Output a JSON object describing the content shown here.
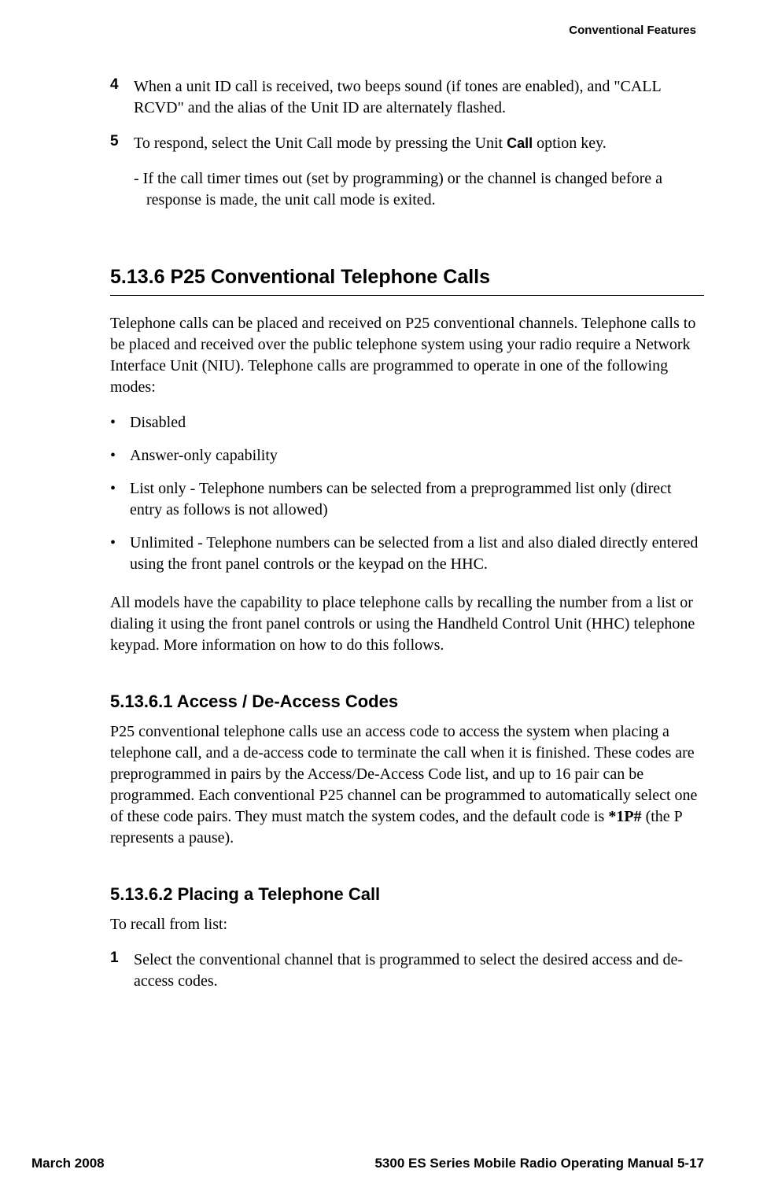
{
  "header": {
    "section_title": "Conventional Features"
  },
  "steps": {
    "step4_num": "4",
    "step4_text": "When a unit ID call is received, two beeps sound (if tones are enabled), and \"CALL RCVD\" and the alias of the Unit ID are alternately flashed.",
    "step5_num": "5",
    "step5_text_a": "To respond, select the Unit Call mode by pressing the Unit ",
    "step5_bold": "Call",
    "step5_text_b": " option key.",
    "step5_sub": "-  If the call timer times out (set by programming) or the channel is changed before a response is made, the unit call mode is exited."
  },
  "section_5_13_6": {
    "heading": "5.13.6   P25 Conventional Telephone Calls",
    "para_intro": "Telephone calls can be placed and received on P25 conventional channels. Telephone calls to be placed and received over the public telephone system using your radio require a Network Interface Unit (NIU). Telephone calls are programmed to operate in one of the following modes:",
    "bullets": {
      "b1": "Disabled",
      "b2": "Answer-only capability",
      "b3": "List only - Telephone numbers can be selected from a preprogrammed list only (direct entry as follows is not allowed)",
      "b4": "Unlimited - Telephone numbers can be selected from a list and also dialed directly entered using the front panel controls or the keypad on the HHC."
    },
    "para_outro": "All models have the capability to place telephone calls by recalling the number from a list or dialing it using the front panel controls or using the Handheld Control Unit (HHC) telephone keypad. More information on how to do this follows."
  },
  "section_5_13_6_1": {
    "heading": "5.13.6.1     Access / De-Access Codes",
    "para_a": "P25 conventional telephone calls use an access code to access the system when placing a telephone call, and a de-access code to terminate the call when it is finished. These codes are preprogrammed in pairs by the Access/De-Access Code list, and up to 16 pair can be programmed. Each conventional P25 channel can be programmed to automatically select one of these code pairs. They must match the system codes, and the default code is ",
    "code": "*1P#",
    "para_b": " (the P represents a pause)."
  },
  "section_5_13_6_2": {
    "heading": "5.13.6.2     Placing a Telephone Call",
    "para_intro": "To recall from list:",
    "step1_num": "1",
    "step1_text": "Select the conventional channel that is programmed to select the desired access and de-access codes."
  },
  "footer": {
    "left": "March 2008",
    "right": "5300 ES Series Mobile Radio Operating Manual    5-17"
  }
}
